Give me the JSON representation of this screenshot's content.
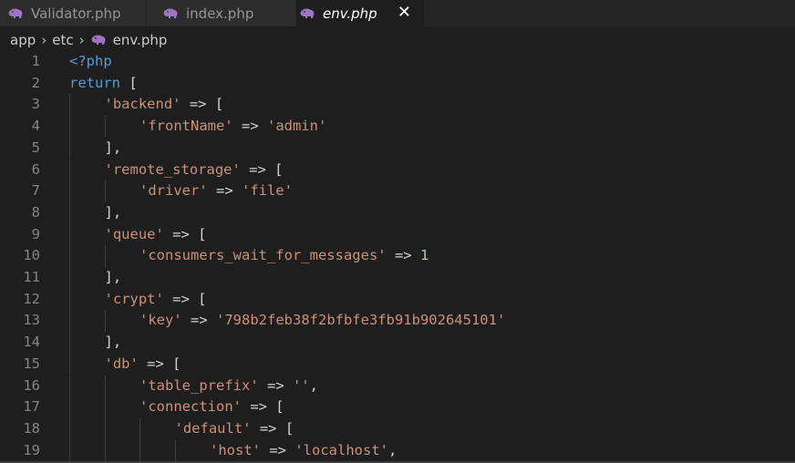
{
  "tabs": [
    {
      "label": "Validator.php",
      "active": false
    },
    {
      "label": "index.php",
      "active": false
    },
    {
      "label": "env.php",
      "active": true
    }
  ],
  "close_glyph": "✕",
  "breadcrumb": {
    "parts": [
      "app",
      "etc",
      "env.php"
    ],
    "separator": "›"
  },
  "colors": {
    "keyword": "#569cd6",
    "string": "#ce9178",
    "number": "#b5cea8",
    "punctuation": "#d4d4d4",
    "php_icon": "#a074c4"
  },
  "code_lines": [
    {
      "num": "1",
      "indent": 0,
      "tokens": [
        {
          "t": "k",
          "v": "<?php"
        }
      ]
    },
    {
      "num": "2",
      "indent": 0,
      "tokens": [
        {
          "t": "kw",
          "v": "return"
        },
        {
          "t": "p",
          "v": " ["
        }
      ]
    },
    {
      "num": "3",
      "indent": 1,
      "tokens": [
        {
          "t": "s",
          "v": "'backend'"
        },
        {
          "t": "p",
          "v": " => ["
        }
      ]
    },
    {
      "num": "4",
      "indent": 2,
      "tokens": [
        {
          "t": "s",
          "v": "'frontName'"
        },
        {
          "t": "p",
          "v": " => "
        },
        {
          "t": "s",
          "v": "'admin'"
        }
      ]
    },
    {
      "num": "5",
      "indent": 1,
      "tokens": [
        {
          "t": "p",
          "v": "],"
        }
      ]
    },
    {
      "num": "6",
      "indent": 1,
      "tokens": [
        {
          "t": "s",
          "v": "'remote_storage'"
        },
        {
          "t": "p",
          "v": " => ["
        }
      ]
    },
    {
      "num": "7",
      "indent": 2,
      "tokens": [
        {
          "t": "s",
          "v": "'driver'"
        },
        {
          "t": "p",
          "v": " => "
        },
        {
          "t": "s",
          "v": "'file'"
        }
      ]
    },
    {
      "num": "8",
      "indent": 1,
      "tokens": [
        {
          "t": "p",
          "v": "],"
        }
      ]
    },
    {
      "num": "9",
      "indent": 1,
      "tokens": [
        {
          "t": "s",
          "v": "'queue'"
        },
        {
          "t": "p",
          "v": " => ["
        }
      ]
    },
    {
      "num": "10",
      "indent": 2,
      "tokens": [
        {
          "t": "s",
          "v": "'consumers_wait_for_messages'"
        },
        {
          "t": "p",
          "v": " => "
        },
        {
          "t": "n",
          "v": "1"
        }
      ]
    },
    {
      "num": "11",
      "indent": 1,
      "tokens": [
        {
          "t": "p",
          "v": "],"
        }
      ]
    },
    {
      "num": "12",
      "indent": 1,
      "tokens": [
        {
          "t": "s",
          "v": "'crypt'"
        },
        {
          "t": "p",
          "v": " => ["
        }
      ]
    },
    {
      "num": "13",
      "indent": 2,
      "tokens": [
        {
          "t": "s",
          "v": "'key'"
        },
        {
          "t": "p",
          "v": " => "
        },
        {
          "t": "s",
          "v": "'798b2feb38f2bfbfe3fb91b902645101'"
        }
      ]
    },
    {
      "num": "14",
      "indent": 1,
      "tokens": [
        {
          "t": "p",
          "v": "],"
        }
      ]
    },
    {
      "num": "15",
      "indent": 1,
      "tokens": [
        {
          "t": "s",
          "v": "'db'"
        },
        {
          "t": "p",
          "v": " => ["
        }
      ]
    },
    {
      "num": "16",
      "indent": 2,
      "tokens": [
        {
          "t": "s",
          "v": "'table_prefix'"
        },
        {
          "t": "p",
          "v": " => "
        },
        {
          "t": "s",
          "v": "''"
        },
        {
          "t": "p",
          "v": ","
        }
      ]
    },
    {
      "num": "17",
      "indent": 2,
      "tokens": [
        {
          "t": "s",
          "v": "'connection'"
        },
        {
          "t": "p",
          "v": " => ["
        }
      ]
    },
    {
      "num": "18",
      "indent": 3,
      "tokens": [
        {
          "t": "s",
          "v": "'default'"
        },
        {
          "t": "p",
          "v": " => ["
        }
      ]
    },
    {
      "num": "19",
      "indent": 4,
      "tokens": [
        {
          "t": "s",
          "v": "'host'"
        },
        {
          "t": "p",
          "v": " => "
        },
        {
          "t": "s",
          "v": "'localhost'"
        },
        {
          "t": "p",
          "v": ","
        }
      ]
    }
  ]
}
